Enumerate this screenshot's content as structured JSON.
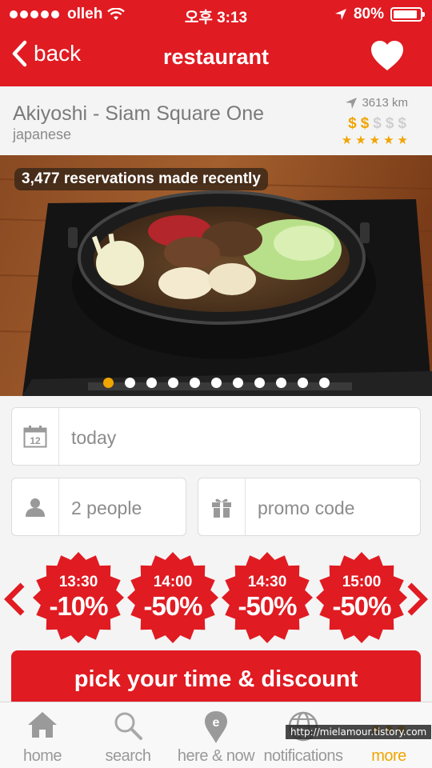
{
  "status_bar": {
    "carrier": "olleh",
    "time": "오후 3:13",
    "battery": "80%"
  },
  "nav": {
    "back_label": "back",
    "title": "restaurant"
  },
  "restaurant": {
    "name": "Akiyoshi - Siam Square One",
    "cuisine": "japanese",
    "distance": "3613 km",
    "price_level": 2,
    "price_max": 5,
    "price_symbol": "$",
    "rating": 5
  },
  "photo": {
    "badge": "3,477 reservations made recently",
    "page_count": 11,
    "active_page": 0
  },
  "form": {
    "date_calendar_number": "12",
    "date_value": "today",
    "people_value": "2 people",
    "promo_placeholder": "promo code"
  },
  "slots": [
    {
      "time": "13:30",
      "discount": "-10%"
    },
    {
      "time": "14:00",
      "discount": "-50%"
    },
    {
      "time": "14:30",
      "discount": "-50%"
    },
    {
      "time": "15:00",
      "discount": "-50%"
    }
  ],
  "cta_label": "pick your time & discount",
  "tabs": [
    {
      "label": "home",
      "icon": "home-icon"
    },
    {
      "label": "search",
      "icon": "search-icon"
    },
    {
      "label": "here & now",
      "icon": "location-pin-icon"
    },
    {
      "label": "notifications",
      "icon": "globe-icon"
    },
    {
      "label": "more",
      "icon": "more-dots-icon"
    }
  ],
  "active_tab": "more",
  "watermark": "http://mielamour.tistory.com",
  "colors": {
    "brand_red": "#e01b22",
    "accent_orange": "#f0a500"
  }
}
